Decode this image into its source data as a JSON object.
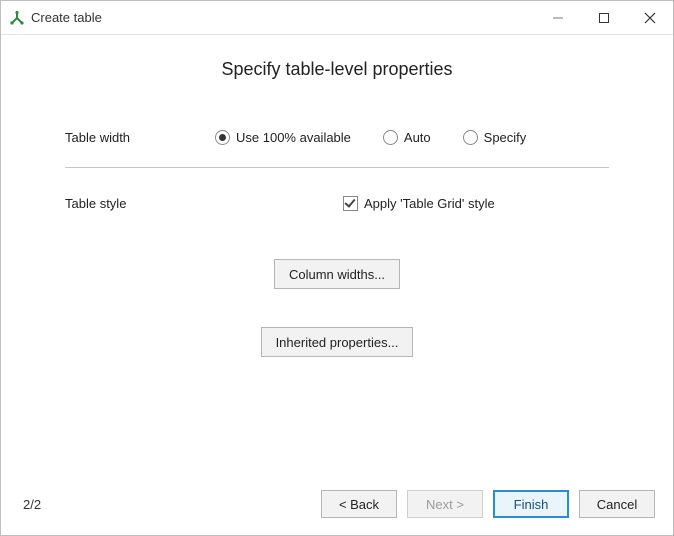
{
  "window": {
    "title": "Create table"
  },
  "heading": "Specify table-level properties",
  "form": {
    "width": {
      "label": "Table width",
      "options": {
        "use100": "Use 100% available",
        "auto": "Auto",
        "specify": "Specify"
      },
      "selected": "use100"
    },
    "style": {
      "label": "Table style",
      "checkbox_label": "Apply 'Table Grid' style",
      "checked": true
    },
    "buttons": {
      "column_widths": "Column widths...",
      "inherited": "Inherited properties..."
    }
  },
  "footer": {
    "page": "2/2",
    "back": "< Back",
    "next": "Next >",
    "finish": "Finish",
    "cancel": "Cancel"
  }
}
